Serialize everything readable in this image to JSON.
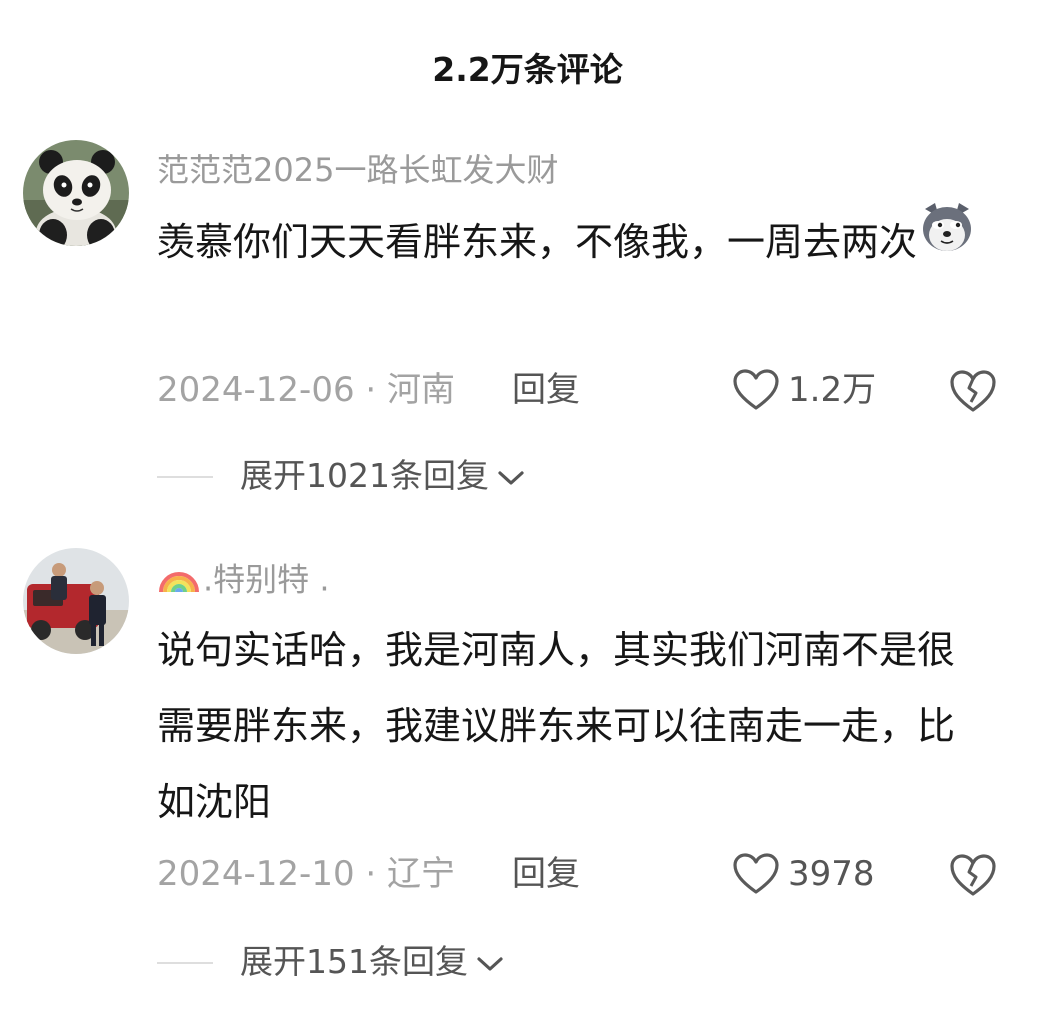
{
  "header": {
    "title": "2.2万条评论"
  },
  "comments": [
    {
      "username": "范范范2025一路长虹发大财",
      "text": "羡慕你们天天看胖东来，不像我，一周去两次",
      "emoji": "doge-emoji",
      "date_location": "2024-12-06 · 河南",
      "reply_label": "回复",
      "likes": "1.2万",
      "expand_label": "展开1021条回复",
      "avatar": "panda"
    },
    {
      "username_prefix_icon": "rainbow-icon",
      "username": ".特别特 .",
      "text": "说句实话哈，我是河南人，其实我们河南不是很需要胖东来，我建议胖东来可以往南走一走，比如沈阳",
      "date_location": "2024-12-10 · 辽宁",
      "reply_label": "回复",
      "likes": "3978",
      "expand_label": "展开151条回复",
      "avatar": "people-red-car"
    }
  ],
  "colors": {
    "muted": "#9a9a9a",
    "text": "#161616",
    "action": "#555555",
    "divider": "#dedede"
  }
}
